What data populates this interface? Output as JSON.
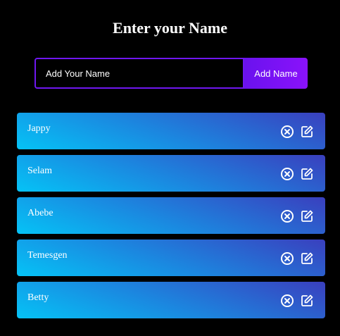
{
  "header": {
    "title": "Enter your Name"
  },
  "form": {
    "input_placeholder": "Add Your Name",
    "input_value": "",
    "add_button_label": "Add Name"
  },
  "names": [
    {
      "label": "Jappy"
    },
    {
      "label": "Selam"
    },
    {
      "label": "Abebe"
    },
    {
      "label": "Temesgen"
    },
    {
      "label": "Betty"
    }
  ],
  "icons": {
    "delete": "close-circle-icon",
    "edit": "edit-icon"
  },
  "colors": {
    "background": "#000000",
    "accent": "#6f17f0",
    "button_gradient_start": "#6a12ee",
    "button_gradient_end": "#8a12fb",
    "item_gradient_start": "#3a3fbe",
    "item_gradient_end": "#05c3f6",
    "text": "#ffffff"
  }
}
